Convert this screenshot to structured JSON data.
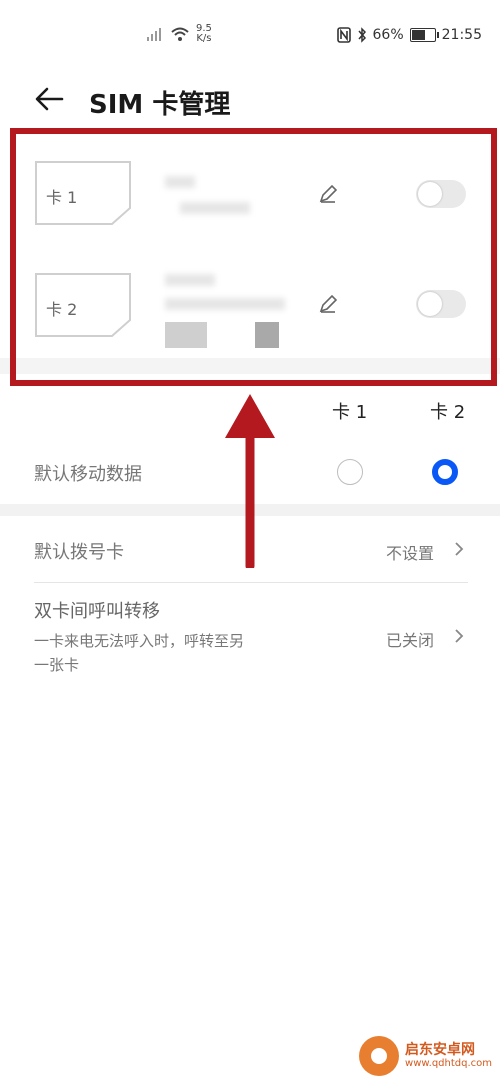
{
  "status_bar": {
    "net_speed_value": "9.5",
    "net_speed_unit": "K/s",
    "battery": "66%",
    "time": "21:55",
    "battery_level": 0.66
  },
  "header": {
    "title": "SIM 卡管理"
  },
  "sims": [
    {
      "label": "卡 1",
      "enabled": false
    },
    {
      "label": "卡 2",
      "enabled": false
    }
  ],
  "columns": {
    "card1": "卡 1",
    "card2": "卡 2"
  },
  "default_data": {
    "label": "默认移动数据",
    "selected": "card2"
  },
  "default_dial": {
    "label": "默认拨号卡",
    "value": "不设置"
  },
  "call_forward": {
    "title": "双卡间呼叫转移",
    "description_line1": "一卡来电无法呼入时，呼转至另",
    "description_line2": "一张卡",
    "value": "已关闭"
  },
  "watermark": {
    "name": "启东安卓网",
    "url": "www.qdhtdq.com"
  },
  "colors": {
    "highlight": "#b3191f",
    "accent": "#0a59f7",
    "arrow": "#b3191f"
  }
}
